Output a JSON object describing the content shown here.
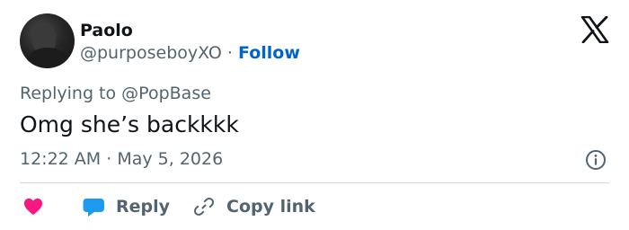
{
  "user": {
    "display_name": "Paolo",
    "handle": "@purposeboyXO",
    "separator": "·",
    "follow_label": "Follow"
  },
  "reply_context": {
    "prefix": "Replying to",
    "target": "@PopBase"
  },
  "tweet": {
    "text": "Omg she’s backkkk",
    "time": "12:22 AM",
    "date_separator": "·",
    "date": "May 5, 2026"
  },
  "actions": {
    "reply_label": "Reply",
    "copy_link_label": "Copy link"
  },
  "icons": {
    "logo": "x-logo-icon",
    "info": "info-icon",
    "like": "heart-icon",
    "reply": "speech-bubble-icon",
    "copy": "link-icon"
  },
  "colors": {
    "follow": "#0064cc",
    "heart": "#f91880",
    "reply_bubble": "#1d9bf0",
    "secondary_text": "#536471"
  }
}
